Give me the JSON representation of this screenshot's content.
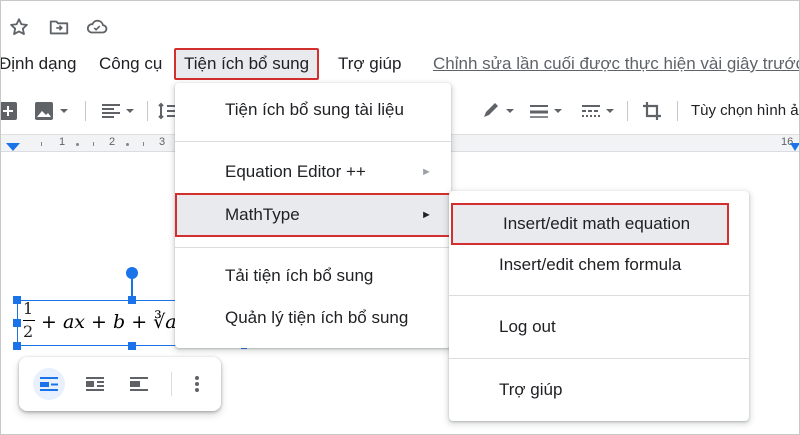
{
  "menubar": {
    "items": [
      "Định dạng",
      "Công cụ",
      "Tiện ích bổ sung",
      "Trợ giúp"
    ],
    "last_edit": "Chỉnh sửa lần cuối được thực hiện vài giây trước"
  },
  "toolbar": {
    "image_options": "Tùy chọn hình ả"
  },
  "ruler": {
    "numbers": [
      "1",
      "1",
      "2",
      "3",
      "16"
    ]
  },
  "equation": {
    "numerator": "1",
    "denominator": "2",
    "expression": "+  ax + b +  ∛a"
  },
  "menu_addons": {
    "items": [
      {
        "label": "Tiện ích bổ sung tài liệu"
      },
      {
        "label": "Equation Editor ++",
        "arrow": "►"
      },
      {
        "label": "MathType",
        "arrow": "►"
      },
      {
        "label": "Tải tiện ích bổ sung"
      },
      {
        "label": "Quản lý tiện ích bổ sung"
      }
    ]
  },
  "menu_mathtype": {
    "items": [
      {
        "label": "Insert/edit math equation"
      },
      {
        "label": "Insert/edit chem formula"
      },
      {
        "label": "Log out"
      },
      {
        "label": "Trợ giúp"
      }
    ]
  },
  "colors": {
    "highlight_border": "#d32f2f",
    "selection_blue": "#1a73e8",
    "hover_bg": "#e8eaed"
  }
}
